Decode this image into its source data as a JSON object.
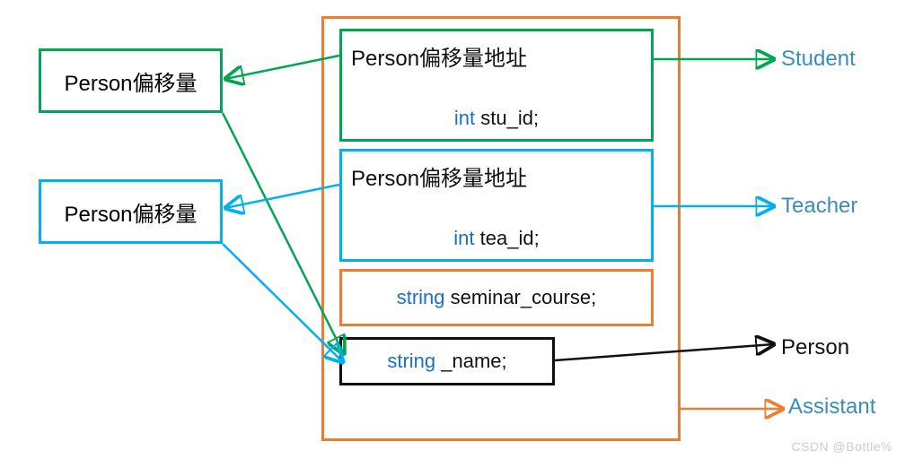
{
  "colors": {
    "green": "#00a651",
    "blue": "#00b0f0",
    "orange": "#ed7d31",
    "black": "#111111",
    "caption": "#3a8db8",
    "typeKw": "#1e6fbf"
  },
  "left": {
    "greenBox": "Person偏移量",
    "blueBox": "Person偏移量"
  },
  "inner": {
    "student": {
      "header": "Person偏移量地址",
      "field_type": "int",
      "field_name": "stu_id;"
    },
    "teacher": {
      "header": "Person偏移量地址",
      "field_type": "int",
      "field_name": "tea_id;"
    },
    "seminar": {
      "field_type": "string",
      "field_name": "seminar_course;"
    },
    "name": {
      "field_type": "string",
      "field_name": "_name;"
    }
  },
  "captions": {
    "student": "Student",
    "teacher": "Teacher",
    "person": "Person",
    "assistant": "Assistant"
  },
  "watermark": "CSDN @Bottle%"
}
